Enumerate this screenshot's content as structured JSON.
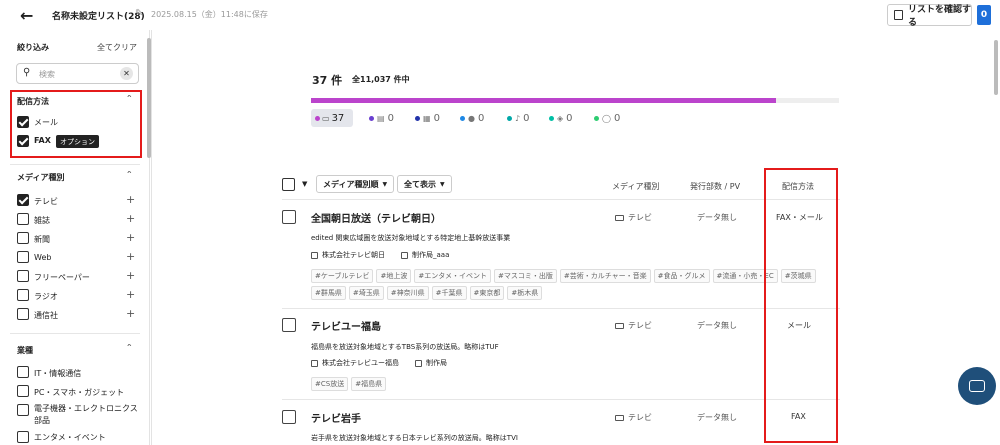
{
  "header": {
    "back_icon": "arrow-left-icon",
    "title": "名称未設定リスト(28)",
    "saved": "2025.08.15（金）11:48に保存",
    "confirm_label": "リストを確認する",
    "confirm_count": "0"
  },
  "sidebar": {
    "filter_title": "絞り込み",
    "clear_all": "全てクリア",
    "search_placeholder": "検索",
    "delivery": {
      "title": "配信方法",
      "items": [
        {
          "label": "メール",
          "checked": true
        },
        {
          "label": "FAX",
          "checked": true,
          "badge": "オプション"
        }
      ]
    },
    "media": {
      "title": "メディア種別",
      "items": [
        {
          "label": "テレビ",
          "checked": true
        },
        {
          "label": "雑誌"
        },
        {
          "label": "新聞"
        },
        {
          "label": "Web"
        },
        {
          "label": "フリーペーパー"
        },
        {
          "label": "ラジオ"
        },
        {
          "label": "通信社"
        }
      ]
    },
    "industry": {
      "title": "業種",
      "items": [
        {
          "label": "IT・情報通信"
        },
        {
          "label": "PC・スマホ・ガジェット"
        },
        {
          "label": "電子機器・エレクトロニクス部品"
        },
        {
          "label": "エンタメ・イベント"
        }
      ]
    }
  },
  "summary": {
    "count": "37 件",
    "total": "全11,037 件中",
    "progress_fraction": 0.88,
    "media_stats": [
      {
        "icon": "tv-icon",
        "value": "37",
        "color": "#bb44cc"
      },
      {
        "icon": "magazine-icon",
        "value": "0",
        "color": "#6a3fd0"
      },
      {
        "icon": "newspaper-icon",
        "value": "0",
        "color": "#2233aa"
      },
      {
        "icon": "web-icon",
        "value": "0",
        "color": "#1e88e5"
      },
      {
        "icon": "radio-icon",
        "value": "0",
        "color": "#00a8a8"
      },
      {
        "icon": "agency-icon",
        "value": "0",
        "color": "#00bfa5"
      },
      {
        "icon": "free-paper-icon",
        "value": "0",
        "color": "#2ecc71"
      }
    ]
  },
  "table": {
    "sort_label": "メディア種別順",
    "filter_label": "全て表示",
    "col_media": "メディア種別",
    "col_circ": "発行部数 / PV",
    "col_deliv": "配信方法",
    "rows": [
      {
        "name": "全国朝日放送（テレビ朝日）",
        "desc": "edited 関東広域圏を放送対象地域とする特定地上基幹放送事業",
        "company": "株式会社テレビ朝日",
        "dept": "制作局_aaa",
        "media": "テレビ",
        "circ": "データ無し",
        "deliv": "FAX・メール",
        "tags": [
          "#ケーブルテレビ",
          "#地上波",
          "#エンタメ・イベント",
          "#マスコミ・出版",
          "#芸術・カルチャー・音楽",
          "#食品・グルメ",
          "#流通・小売・EC",
          "#茨城県",
          "#群馬県",
          "#埼玉県",
          "#神奈川県",
          "#千葉県",
          "#東京都",
          "#栃木県"
        ]
      },
      {
        "name": "テレビユー福島",
        "desc": "福島県を放送対象地域とするTBS系列の放送局。略称はTUF",
        "company": "株式会社テレビユー福島",
        "dept": "制作局",
        "media": "テレビ",
        "circ": "データ無し",
        "deliv": "メール",
        "tags": [
          "#CS放送",
          "#福島県"
        ]
      },
      {
        "name": "テレビ岩手",
        "desc": "岩手県を放送対象地域とする日本テレビ系列の放送局。略称はTVI",
        "media": "テレビ",
        "circ": "データ無し",
        "deliv": "FAX"
      }
    ]
  }
}
